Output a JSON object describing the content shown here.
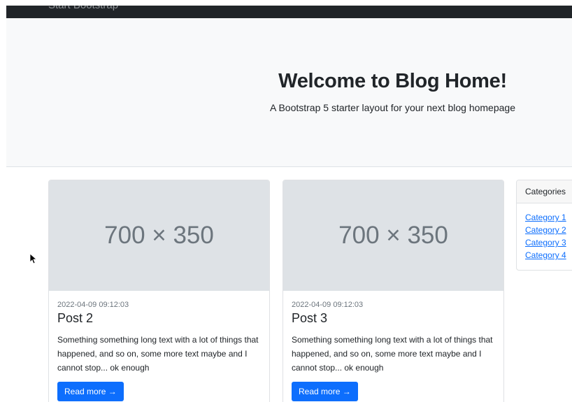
{
  "navbar": {
    "brand": "Start Bootstrap"
  },
  "hero": {
    "title": "Welcome to Blog Home!",
    "subtitle": "A Bootstrap 5 starter layout for your next blog homepage"
  },
  "posts": [
    {
      "image_placeholder": "700 × 350",
      "date": "2022-04-09 09:12:03",
      "title": "Post 2",
      "text": "Something something long text with a lot of things that happened, and so on, some more text maybe and I cannot stop... ok enough",
      "button": "Read more →"
    },
    {
      "image_placeholder": "700 × 350",
      "date": "2022-04-09 09:12:03",
      "title": "Post 3",
      "text": "Something something long text with a lot of things that happened, and so on, some more text maybe and I cannot stop... ok enough",
      "button": "Read more →"
    }
  ],
  "sidebar": {
    "categories_header": "Categories",
    "categories": [
      "Category 1",
      "Category 2",
      "Category 3",
      "Category 4"
    ]
  },
  "colors": {
    "navbar_bg": "#212529",
    "hero_bg": "#f8f9fa",
    "primary": "#0d6efd",
    "image_placeholder_bg": "#dee2e6"
  },
  "icons": {
    "cursor": "mouse-pointer-icon"
  }
}
